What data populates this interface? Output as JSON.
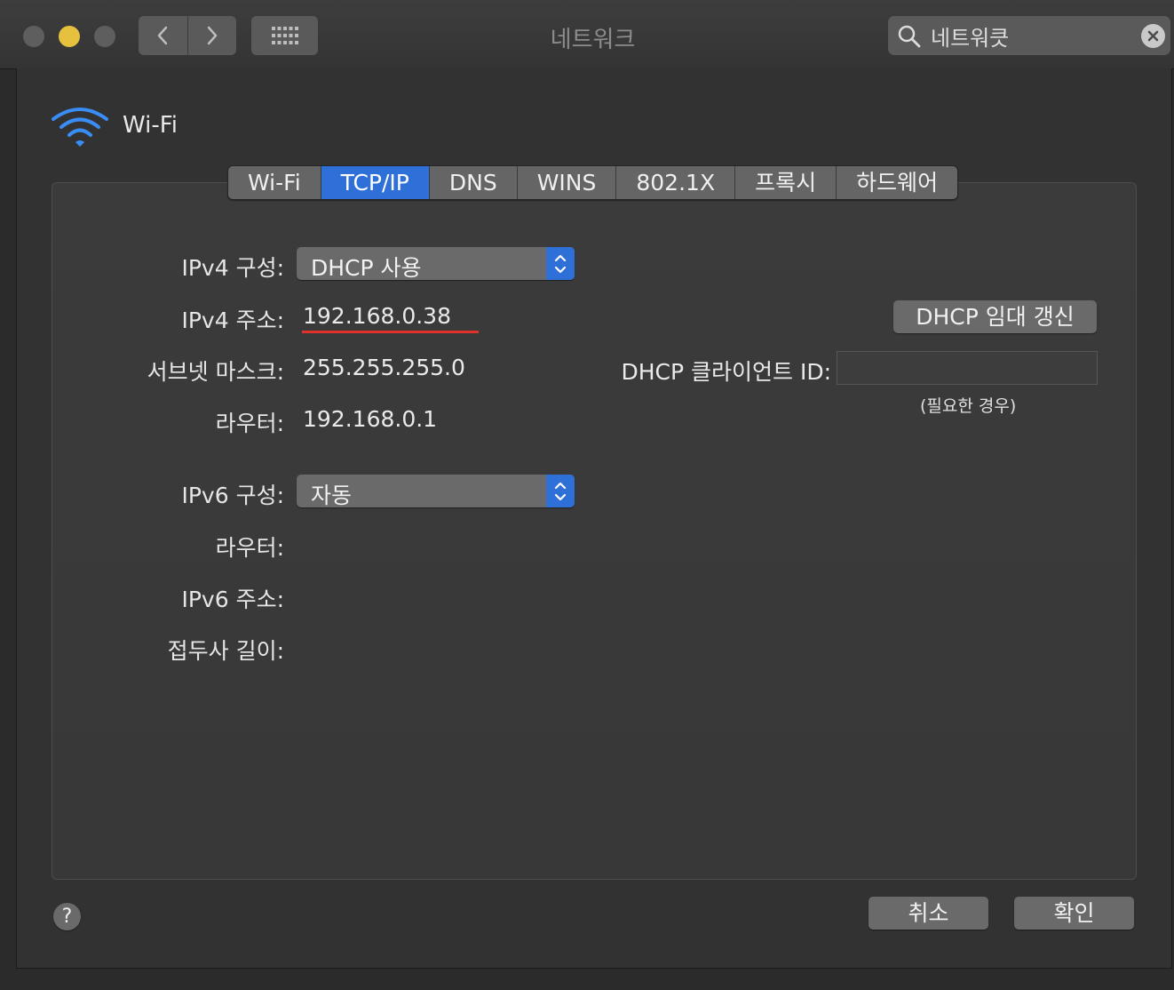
{
  "window": {
    "title": "네트워크"
  },
  "search": {
    "value": "네트워큿"
  },
  "service": {
    "name": "Wi-Fi"
  },
  "tabs": [
    "Wi-Fi",
    "TCP/IP",
    "DNS",
    "WINS",
    "802.1X",
    "프록시",
    "하드웨어"
  ],
  "active_tab": "TCP/IP",
  "ipv4": {
    "config_label": "IPv4 구성:",
    "config_value": "DHCP 사용",
    "address_label": "IPv4 주소:",
    "address_value": "192.168.0.38",
    "subnet_label": "서브넷 마스크:",
    "subnet_value": "255.255.255.0",
    "router_label": "라우터:",
    "router_value": "192.168.0.1"
  },
  "dhcp": {
    "renew_label": "DHCP 임대 갱신",
    "client_id_label": "DHCP 클라이언트 ID:",
    "client_id_value": "",
    "client_id_hint": "(필요한 경우)"
  },
  "ipv6": {
    "config_label": "IPv6 구성:",
    "config_value": "자동",
    "router_label": "라우터:",
    "address_label": "IPv6 주소:",
    "prefix_label": "접두사 길이:"
  },
  "buttons": {
    "cancel": "취소",
    "ok": "확인",
    "help": "?"
  },
  "colors": {
    "accent": "#2f6fd8",
    "highlight_underline": "#e0322a",
    "minimize_light": "#e5c13d"
  }
}
